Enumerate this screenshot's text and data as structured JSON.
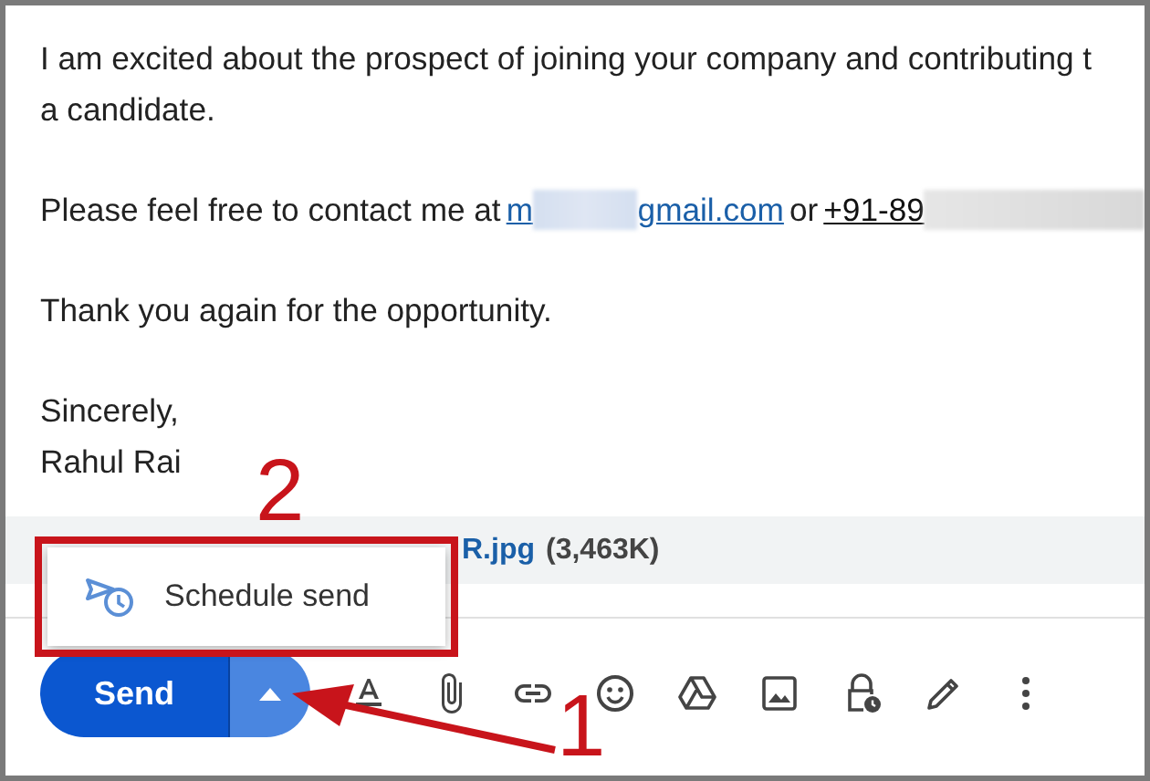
{
  "message": [
    {
      "kind": "lines",
      "lines": [
        "I am excited about the prospect of joining your company and contributing t",
        "a candidate."
      ]
    },
    {
      "kind": "contact",
      "text": "Please feel free to contact me at",
      "email_start": "m",
      "email_end": "gmail.com",
      "joiner": "or",
      "phone": "+91-89"
    },
    {
      "kind": "lines",
      "lines": [
        "Thank you again for the opportunity."
      ]
    },
    {
      "kind": "lines",
      "lines": [
        "Sincerely,",
        "Rahul Rai"
      ]
    }
  ],
  "attachment": {
    "name": "R.jpg",
    "size": "(3,463K)"
  },
  "send_button": {
    "label": "Send",
    "options_expanded": true
  },
  "menu": {
    "items": [
      {
        "label": "Schedule send"
      }
    ]
  },
  "toolbar": [
    {
      "kind": "format"
    },
    {
      "kind": "attach"
    },
    {
      "kind": "link"
    },
    {
      "kind": "emoji"
    },
    {
      "kind": "drive"
    },
    {
      "kind": "photo"
    },
    {
      "kind": "confidential"
    },
    {
      "kind": "signature"
    },
    {
      "kind": "more"
    }
  ],
  "annotations": {
    "menu_label": "2",
    "arrow_label": "1"
  }
}
